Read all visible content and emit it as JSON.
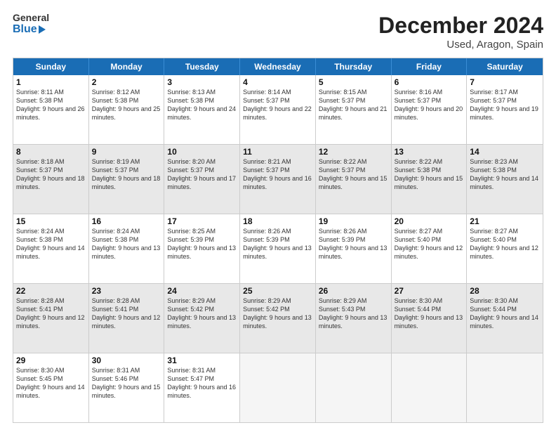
{
  "header": {
    "logo_general": "General",
    "logo_blue": "Blue",
    "title": "December 2024",
    "subtitle": "Used, Aragon, Spain"
  },
  "days_of_week": [
    "Sunday",
    "Monday",
    "Tuesday",
    "Wednesday",
    "Thursday",
    "Friday",
    "Saturday"
  ],
  "weeks": [
    [
      {
        "day": "1",
        "sunrise": "Sunrise: 8:11 AM",
        "sunset": "Sunset: 5:38 PM",
        "daylight": "Daylight: 9 hours and 26 minutes."
      },
      {
        "day": "2",
        "sunrise": "Sunrise: 8:12 AM",
        "sunset": "Sunset: 5:38 PM",
        "daylight": "Daylight: 9 hours and 25 minutes."
      },
      {
        "day": "3",
        "sunrise": "Sunrise: 8:13 AM",
        "sunset": "Sunset: 5:38 PM",
        "daylight": "Daylight: 9 hours and 24 minutes."
      },
      {
        "day": "4",
        "sunrise": "Sunrise: 8:14 AM",
        "sunset": "Sunset: 5:37 PM",
        "daylight": "Daylight: 9 hours and 22 minutes."
      },
      {
        "day": "5",
        "sunrise": "Sunrise: 8:15 AM",
        "sunset": "Sunset: 5:37 PM",
        "daylight": "Daylight: 9 hours and 21 minutes."
      },
      {
        "day": "6",
        "sunrise": "Sunrise: 8:16 AM",
        "sunset": "Sunset: 5:37 PM",
        "daylight": "Daylight: 9 hours and 20 minutes."
      },
      {
        "day": "7",
        "sunrise": "Sunrise: 8:17 AM",
        "sunset": "Sunset: 5:37 PM",
        "daylight": "Daylight: 9 hours and 19 minutes."
      }
    ],
    [
      {
        "day": "8",
        "sunrise": "Sunrise: 8:18 AM",
        "sunset": "Sunset: 5:37 PM",
        "daylight": "Daylight: 9 hours and 18 minutes."
      },
      {
        "day": "9",
        "sunrise": "Sunrise: 8:19 AM",
        "sunset": "Sunset: 5:37 PM",
        "daylight": "Daylight: 9 hours and 18 minutes."
      },
      {
        "day": "10",
        "sunrise": "Sunrise: 8:20 AM",
        "sunset": "Sunset: 5:37 PM",
        "daylight": "Daylight: 9 hours and 17 minutes."
      },
      {
        "day": "11",
        "sunrise": "Sunrise: 8:21 AM",
        "sunset": "Sunset: 5:37 PM",
        "daylight": "Daylight: 9 hours and 16 minutes."
      },
      {
        "day": "12",
        "sunrise": "Sunrise: 8:22 AM",
        "sunset": "Sunset: 5:37 PM",
        "daylight": "Daylight: 9 hours and 15 minutes."
      },
      {
        "day": "13",
        "sunrise": "Sunrise: 8:22 AM",
        "sunset": "Sunset: 5:38 PM",
        "daylight": "Daylight: 9 hours and 15 minutes."
      },
      {
        "day": "14",
        "sunrise": "Sunrise: 8:23 AM",
        "sunset": "Sunset: 5:38 PM",
        "daylight": "Daylight: 9 hours and 14 minutes."
      }
    ],
    [
      {
        "day": "15",
        "sunrise": "Sunrise: 8:24 AM",
        "sunset": "Sunset: 5:38 PM",
        "daylight": "Daylight: 9 hours and 14 minutes."
      },
      {
        "day": "16",
        "sunrise": "Sunrise: 8:24 AM",
        "sunset": "Sunset: 5:38 PM",
        "daylight": "Daylight: 9 hours and 13 minutes."
      },
      {
        "day": "17",
        "sunrise": "Sunrise: 8:25 AM",
        "sunset": "Sunset: 5:39 PM",
        "daylight": "Daylight: 9 hours and 13 minutes."
      },
      {
        "day": "18",
        "sunrise": "Sunrise: 8:26 AM",
        "sunset": "Sunset: 5:39 PM",
        "daylight": "Daylight: 9 hours and 13 minutes."
      },
      {
        "day": "19",
        "sunrise": "Sunrise: 8:26 AM",
        "sunset": "Sunset: 5:39 PM",
        "daylight": "Daylight: 9 hours and 13 minutes."
      },
      {
        "day": "20",
        "sunrise": "Sunrise: 8:27 AM",
        "sunset": "Sunset: 5:40 PM",
        "daylight": "Daylight: 9 hours and 12 minutes."
      },
      {
        "day": "21",
        "sunrise": "Sunrise: 8:27 AM",
        "sunset": "Sunset: 5:40 PM",
        "daylight": "Daylight: 9 hours and 12 minutes."
      }
    ],
    [
      {
        "day": "22",
        "sunrise": "Sunrise: 8:28 AM",
        "sunset": "Sunset: 5:41 PM",
        "daylight": "Daylight: 9 hours and 12 minutes."
      },
      {
        "day": "23",
        "sunrise": "Sunrise: 8:28 AM",
        "sunset": "Sunset: 5:41 PM",
        "daylight": "Daylight: 9 hours and 12 minutes."
      },
      {
        "day": "24",
        "sunrise": "Sunrise: 8:29 AM",
        "sunset": "Sunset: 5:42 PM",
        "daylight": "Daylight: 9 hours and 13 minutes."
      },
      {
        "day": "25",
        "sunrise": "Sunrise: 8:29 AM",
        "sunset": "Sunset: 5:42 PM",
        "daylight": "Daylight: 9 hours and 13 minutes."
      },
      {
        "day": "26",
        "sunrise": "Sunrise: 8:29 AM",
        "sunset": "Sunset: 5:43 PM",
        "daylight": "Daylight: 9 hours and 13 minutes."
      },
      {
        "day": "27",
        "sunrise": "Sunrise: 8:30 AM",
        "sunset": "Sunset: 5:44 PM",
        "daylight": "Daylight: 9 hours and 13 minutes."
      },
      {
        "day": "28",
        "sunrise": "Sunrise: 8:30 AM",
        "sunset": "Sunset: 5:44 PM",
        "daylight": "Daylight: 9 hours and 14 minutes."
      }
    ],
    [
      {
        "day": "29",
        "sunrise": "Sunrise: 8:30 AM",
        "sunset": "Sunset: 5:45 PM",
        "daylight": "Daylight: 9 hours and 14 minutes."
      },
      {
        "day": "30",
        "sunrise": "Sunrise: 8:31 AM",
        "sunset": "Sunset: 5:46 PM",
        "daylight": "Daylight: 9 hours and 15 minutes."
      },
      {
        "day": "31",
        "sunrise": "Sunrise: 8:31 AM",
        "sunset": "Sunset: 5:47 PM",
        "daylight": "Daylight: 9 hours and 16 minutes."
      },
      {
        "day": "",
        "sunrise": "",
        "sunset": "",
        "daylight": ""
      },
      {
        "day": "",
        "sunrise": "",
        "sunset": "",
        "daylight": ""
      },
      {
        "day": "",
        "sunrise": "",
        "sunset": "",
        "daylight": ""
      },
      {
        "day": "",
        "sunrise": "",
        "sunset": "",
        "daylight": ""
      }
    ]
  ]
}
